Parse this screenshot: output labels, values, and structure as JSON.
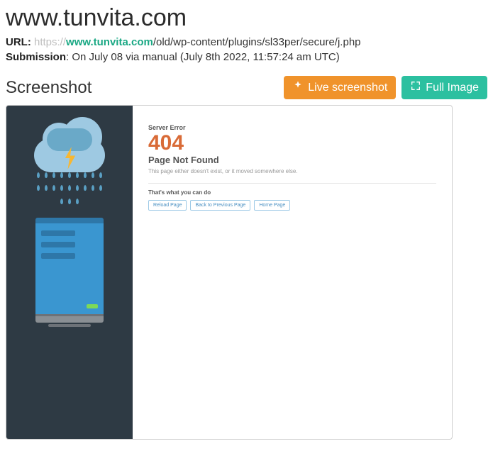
{
  "header": {
    "title": "www.tunvita.com",
    "url_label": "URL:",
    "url_proto": "https://",
    "url_host": "www.tunvita.com",
    "url_path": "/old/wp-content/plugins/sl33per/secure/j.php",
    "submission_label": "Submission",
    "submission_text": ": On July 08 via manual (July 8th 2022, 11:57:24 am UTC)"
  },
  "section": {
    "heading": "Screenshot",
    "live_btn": "Live screenshot",
    "full_btn": "Full Image"
  },
  "error_page": {
    "server_error": "Server Error",
    "code": "404",
    "page_not_found": "Page Not Found",
    "description": "This page either doesn't exist, or it moved somewhere else.",
    "can_do": "That's what you can do",
    "buttons": {
      "reload": "Reload Page",
      "back": "Back to Previous Page",
      "home": "Home Page"
    }
  }
}
